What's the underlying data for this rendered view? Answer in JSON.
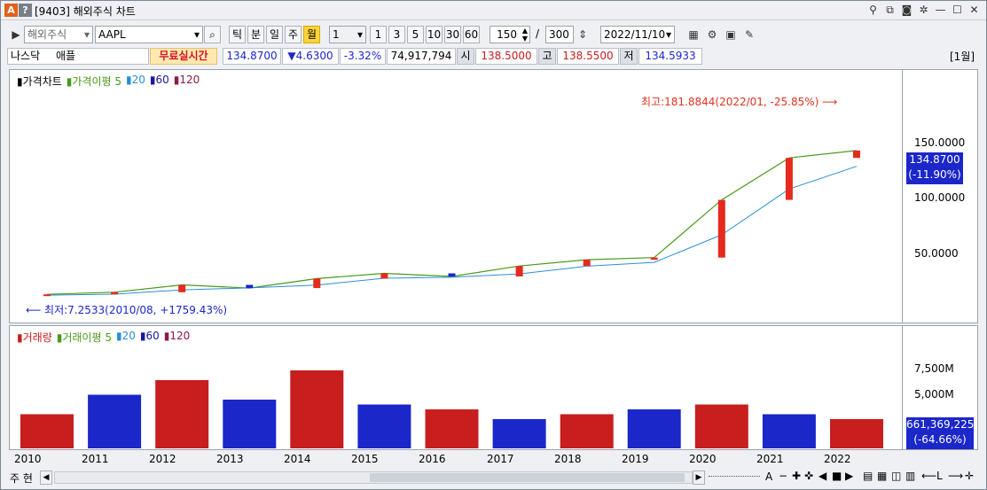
{
  "window": {
    "badge_a": "A",
    "badge_q": "?",
    "title": "[9403] 해외주식 차트"
  },
  "toolbar": {
    "market": "해외주식",
    "symbol": "AAPL",
    "periods": [
      "틱",
      "분",
      "일",
      "주",
      "월"
    ],
    "selected_period": "월",
    "interval": "1",
    "quick_intervals": [
      "1",
      "3",
      "5",
      "10",
      "30",
      "60"
    ],
    "count": "150",
    "separator": "/",
    "total": "300",
    "date": "2022/11/10"
  },
  "info": {
    "exchange": "나스닥",
    "name": "애플",
    "realtime_label": "무료실시간",
    "price": "134.8700",
    "change": "▼4.6300",
    "change_pct": "-3.32%",
    "volume": "74,917,794",
    "open_label": "시",
    "open": "138.5000",
    "high_label": "고",
    "high": "138.5500",
    "low_label": "저",
    "low": "134.5933",
    "period_tag": "[1월]"
  },
  "price_panel": {
    "legend": [
      "가격차트",
      "가격이평 5",
      "20",
      "60",
      "120"
    ],
    "legend_colors": [
      "#000000",
      "#4a9a1a",
      "#2b8ed8",
      "#1616a0",
      "#8b1a4a"
    ],
    "max_annotation": "최고:181.8844(2022/01, -25.85%)",
    "min_annotation": "최저:7.2533(2010/08, +1759.43%)",
    "y_ticks": [
      "150.0000",
      "100.0000",
      "50.0000"
    ],
    "current_price": "134.8700",
    "current_pct": "(-11.90%)"
  },
  "volume_panel": {
    "legend": [
      "거래량",
      "거래이평 5",
      "20",
      "60",
      "120"
    ],
    "legend_colors": [
      "#c81e1e",
      "#4a9a1a",
      "#2b8ed8",
      "#1616a0",
      "#8b1a4a"
    ],
    "y_ticks": [
      "7,500M",
      "5,000M"
    ],
    "current_volume": "661,369,225",
    "current_pct": "(-64.66%)"
  },
  "x_axis": [
    "2010",
    "2011",
    "2012",
    "2013",
    "2014",
    "2015",
    "2016",
    "2017",
    "2018",
    "2019",
    "2020",
    "2021",
    "2022"
  ],
  "bottom": {
    "mode": "주 현",
    "zoom_letters": [
      "A"
    ]
  },
  "chart_data": {
    "type": "bar",
    "title": "",
    "x": [
      "2010",
      "2011",
      "2012",
      "2013",
      "2014",
      "2015",
      "2016",
      "2017",
      "2018",
      "2019",
      "2020",
      "2021",
      "2022"
    ],
    "series": [
      {
        "name": "가격차트",
        "values": [
          10,
          12,
          19,
          16,
          25,
          30,
          27,
          37,
          43,
          45,
          100,
          140,
          147
        ]
      }
    ],
    "ylim": [
      0,
      190
    ],
    "ylabel": ""
  }
}
